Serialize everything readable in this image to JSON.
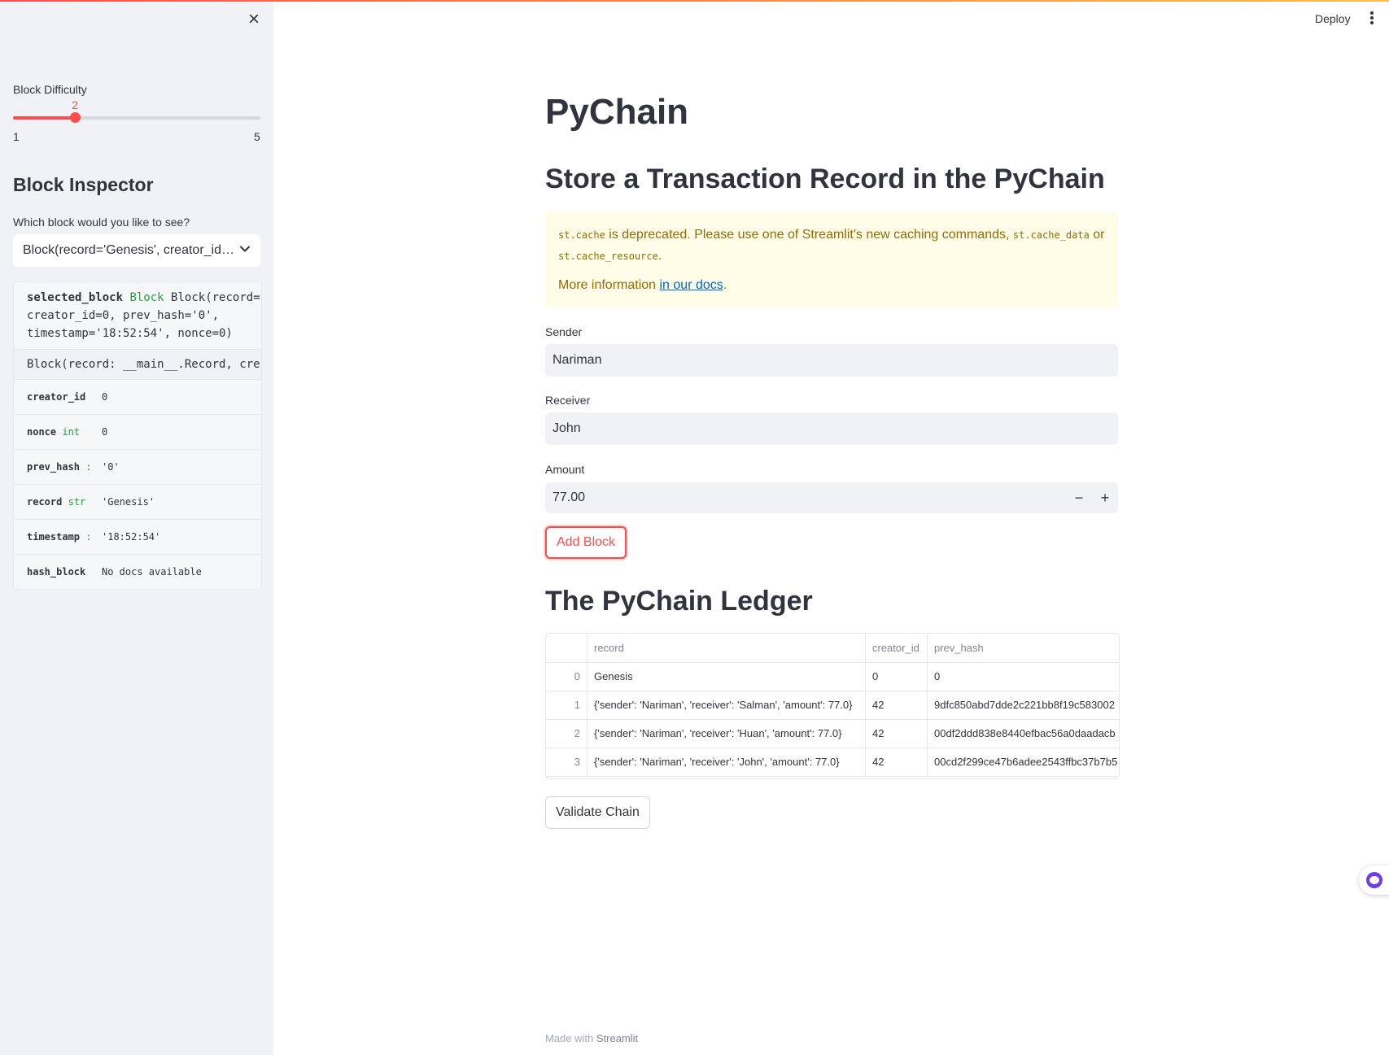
{
  "header": {
    "deploy_label": "Deploy",
    "menu_icon": "more-vertical-icon",
    "accent_gradient": [
      "#ff4b4b",
      "#ffbd45"
    ]
  },
  "sidebar": {
    "close_icon": "×",
    "difficulty": {
      "label": "Block Difficulty",
      "value": "2",
      "min": "1",
      "max": "5",
      "fraction": 0.25,
      "color": "#ff4b4b"
    },
    "inspector": {
      "title": "Block Inspector",
      "select_label": "Which block would you like to see?",
      "selected_value": "Block(record='Genesis', creator_id…",
      "chevron_icon": "chevron-down-icon"
    },
    "help": {
      "sig_name": "selected_block",
      "sig_type": "Block",
      "sig_line1": "Block(record=",
      "sig_line2": "creator_id=0, prev_hash='0',",
      "sig_line3": "timestamp='18:52:54', nonce=0)",
      "doc": "Block(record: __main__.Record, cre",
      "rows": [
        {
          "key": "creator_id",
          "type": "",
          "value": "0"
        },
        {
          "key": "nonce",
          "type": "int",
          "value": "0"
        },
        {
          "key": "prev_hash",
          "type": ":",
          "value": "'0'"
        },
        {
          "key": "record",
          "type": "str",
          "value": "'Genesis'"
        },
        {
          "key": "timestamp",
          "type": ":",
          "value": "'18:52:54'"
        },
        {
          "key": "hash_block",
          "type": "",
          "value": "No docs available"
        }
      ]
    }
  },
  "main": {
    "title": "PyChain",
    "subtitle": "Store a Transaction Record in the PyChain",
    "warning": {
      "code1": "st.cache",
      "text1": " is deprecated. Please use one of Streamlit's new caching commands, ",
      "code2": "st.cache_data",
      "text2": " or ",
      "code3": "st.cache_resource",
      "text3": ".",
      "more_prefix": "More information ",
      "link": "in our docs",
      "more_suffix": "."
    },
    "sender": {
      "label": "Sender",
      "value": "Nariman"
    },
    "receiver": {
      "label": "Receiver",
      "value": "John"
    },
    "amount": {
      "label": "Amount",
      "value": "77.00",
      "minus": "−",
      "plus": "+"
    },
    "add_block_label": "Add Block",
    "ledger_title": "The PyChain Ledger",
    "ledger": {
      "columns": [
        "",
        "record",
        "creator_id",
        "prev_hash"
      ],
      "rows": [
        [
          "0",
          "Genesis",
          "0",
          "0"
        ],
        [
          "1",
          "{'sender': 'Nariman', 'receiver': 'Salman', 'amount': 77.0}",
          "42",
          "9dfc850abd7dde2c221bb8f19c583002"
        ],
        [
          "2",
          "{'sender': 'Nariman', 'receiver': 'Huan', 'amount': 77.0}",
          "42",
          "00df2ddd838e8440efbac56a0daadacb"
        ],
        [
          "3",
          "{'sender': 'Nariman', 'receiver': 'John', 'amount': 77.0}",
          "42",
          "00cd2f299ce47b6adee2543ffbc37b7b5"
        ]
      ]
    },
    "validate_label": "Validate Chain"
  },
  "footer": {
    "prefix": "Made with ",
    "brand": "Streamlit"
  }
}
